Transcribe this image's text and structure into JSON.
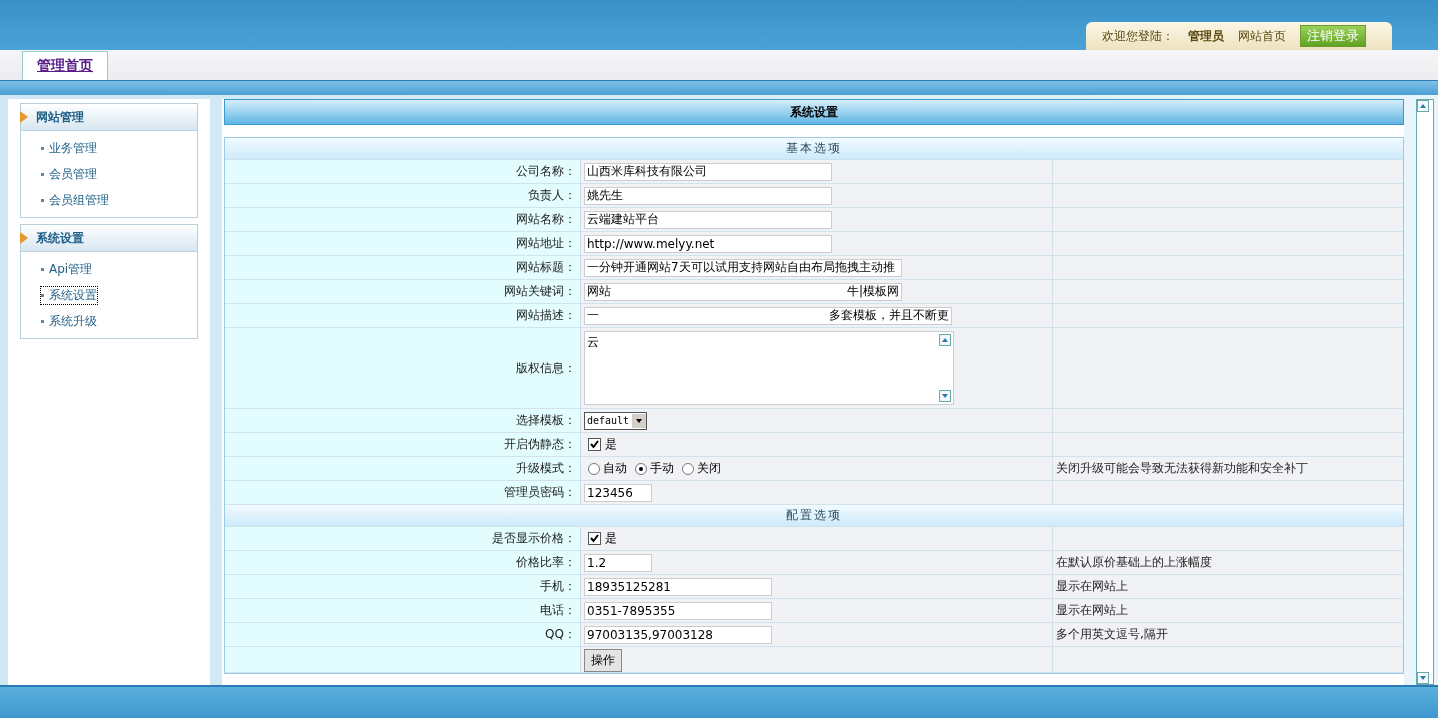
{
  "header": {
    "welcome": "欢迎您登陆：",
    "user": "管理员",
    "home_link": "网站首页",
    "logout": "注销登录"
  },
  "tabs": [
    {
      "label": "管理首页",
      "selected": true
    }
  ],
  "sidebar": [
    {
      "title": "网站管理",
      "items": [
        {
          "label": "业务管理",
          "selected": false
        },
        {
          "label": "会员管理",
          "selected": false
        },
        {
          "label": "会员组管理",
          "selected": false
        }
      ]
    },
    {
      "title": "系统设置",
      "items": [
        {
          "label": "Api管理",
          "selected": false
        },
        {
          "label": "系统设置",
          "selected": true
        },
        {
          "label": "系统升级",
          "selected": false
        }
      ]
    }
  ],
  "panel_title": "系统设置",
  "sections": [
    {
      "title": "基本选项",
      "rows": [
        {
          "label": "公司名称：",
          "kind": "text",
          "value": "山西米库科技有限公司"
        },
        {
          "label": "负责人：",
          "kind": "text",
          "value": "姚先生"
        },
        {
          "label": "网站名称：",
          "kind": "text",
          "value": "云端建站平台"
        },
        {
          "label": "网站地址：",
          "kind": "text",
          "value": "http://www.melyy.net"
        },
        {
          "label": "网站标题：",
          "kind": "wide",
          "value": "一分钟开通网站7天可以试用支持网站自由布局拖拽主动推"
        },
        {
          "label": "网站关键词：",
          "kind": "split",
          "value": "网站",
          "value_end": "牛|模板网"
        },
        {
          "label": "网站描述：",
          "kind": "split",
          "value": "一",
          "value_end": "多套模板，并且不断更"
        },
        {
          "label": "版权信息：",
          "kind": "textarea",
          "value": "云"
        },
        {
          "label": "选择模板：",
          "kind": "select",
          "value": "default"
        },
        {
          "label": "开启伪静态：",
          "kind": "checkbox",
          "checked": true,
          "text": "是"
        },
        {
          "label": "升级模式：",
          "kind": "radio",
          "options": [
            {
              "label": "自动",
              "selected": false
            },
            {
              "label": "手动",
              "selected": true
            },
            {
              "label": "关闭",
              "selected": false
            }
          ],
          "note": "关闭升级可能会导致无法获得新功能和安全补丁"
        },
        {
          "label": "管理员密码：",
          "kind": "short",
          "value": "123456"
        }
      ]
    },
    {
      "title": "配置选项",
      "rows": [
        {
          "label": "是否显示价格：",
          "kind": "checkbox",
          "checked": true,
          "text": "是"
        },
        {
          "label": "价格比率：",
          "kind": "short",
          "value": "1.2",
          "note": "在默认原价基础上的上涨幅度"
        },
        {
          "label": "手机：",
          "kind": "phone",
          "value": "18935125281",
          "note": "显示在网站上"
        },
        {
          "label": "电话：",
          "kind": "phone",
          "value": "0351-7895355",
          "note": "显示在网站上"
        },
        {
          "label": "QQ：",
          "kind": "phone",
          "value": "97003135,97003128",
          "note": "多个用英文逗号,隔开"
        },
        {
          "kind": "button",
          "value": "操作"
        }
      ]
    }
  ]
}
